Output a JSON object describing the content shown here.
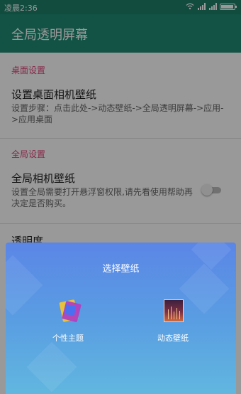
{
  "status_bar": {
    "time": "凌晨2:36"
  },
  "toolbar": {
    "title": "全局透明屏幕"
  },
  "sections": {
    "desktop": {
      "header": "桌面设置",
      "title": "设置桌面相机壁纸",
      "subtitle": "设置步骤：点击此处->动态壁纸->全局透明屏幕->应用->应用桌面"
    },
    "global": {
      "header": "全局设置",
      "title": "全局相机壁纸",
      "subtitle": "设置全局需要打开悬浮窗权限,请先看使用帮助再决定是否购买。",
      "toggle_on": false
    },
    "transparency": {
      "title": "透明度"
    }
  },
  "sheet": {
    "title": "选择壁纸",
    "options": [
      {
        "label": "个性主题",
        "icon": "theme-icon"
      },
      {
        "label": "动态壁纸",
        "icon": "live-wallpaper-icon"
      }
    ]
  },
  "colors": {
    "toolbar": "#1f8a73",
    "accent": "#e0447a"
  }
}
